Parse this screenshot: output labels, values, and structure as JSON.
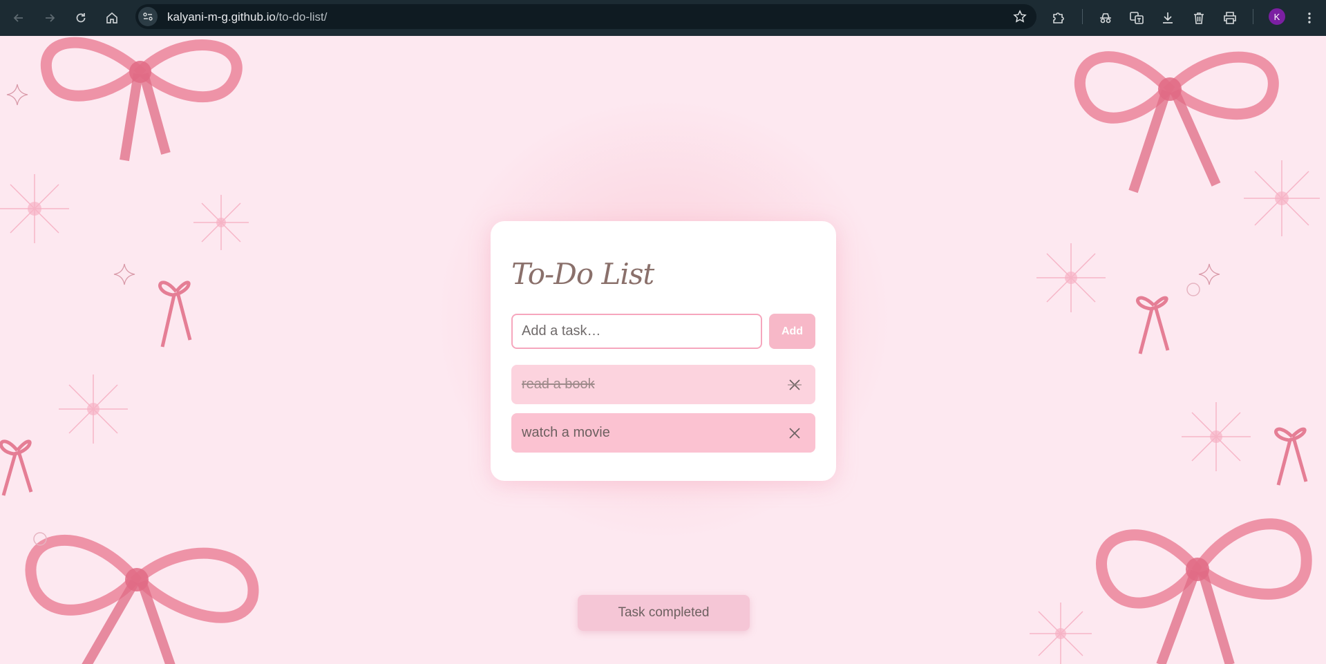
{
  "browser": {
    "url_host": "kalyani-m-g.github.io",
    "url_path": "/to-do-list/",
    "profile_initial": "K",
    "icons": [
      "back-icon",
      "forward-icon",
      "reload-icon",
      "home-icon",
      "site-info-icon",
      "bookmark-star-icon",
      "extensions-icon",
      "incognito-icon",
      "translate-icon",
      "download-icon",
      "delete-icon",
      "print-icon",
      "menu-icon"
    ]
  },
  "app": {
    "title": "To-Do List",
    "input": {
      "placeholder": "Add a task…",
      "value": ""
    },
    "add_label": "Add",
    "tasks": [
      {
        "text": "read a book",
        "completed": true
      },
      {
        "text": "watch a movie",
        "completed": false
      }
    ],
    "toast": "Task completed"
  },
  "colors": {
    "page_background": "#fde8f0",
    "card": "#ffffff",
    "accent": "#f7b8c8",
    "task_done_bg": "#fcd3de",
    "task_active_bg": "#fbc2d1",
    "title": "#8a706b",
    "toast_bg": "#f5c6d6",
    "ribbon": "#e8778f"
  }
}
